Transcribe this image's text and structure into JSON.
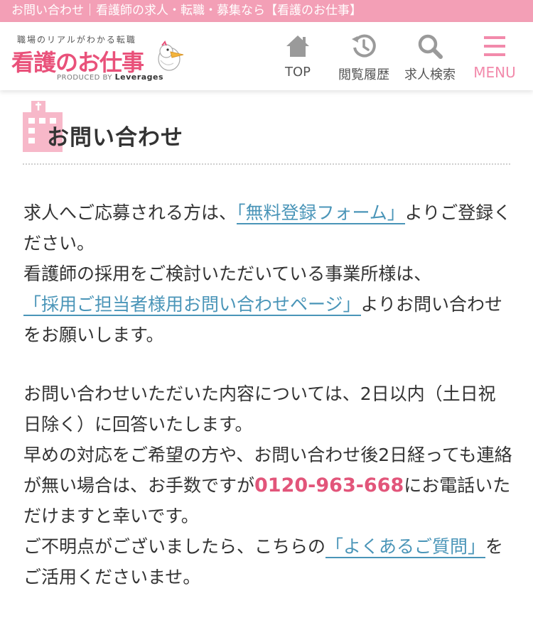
{
  "browser": {
    "page_title": "お問い合わせ｜看護師の求人・転職・募集なら【看護のお仕事】"
  },
  "colors": {
    "brand_pink": "#e9517a",
    "topbar_pink": "#f39fb6",
    "link_blue": "#4a95b8",
    "tel_pink": "#e2557a"
  },
  "header": {
    "logo": {
      "tagline": "職場のリアルがわかる転職",
      "name": "看護のお仕事",
      "produced_by": "PRODUCED BY",
      "company": "Leverages",
      "icon": "pelican-mascot-icon"
    },
    "nav": [
      {
        "label": "TOP",
        "icon": "home-icon"
      },
      {
        "label": "閲覧履歴",
        "icon": "history-icon"
      },
      {
        "label": "求人検索",
        "icon": "search-icon"
      },
      {
        "label": "MENU",
        "icon": "hamburger-menu-icon"
      }
    ]
  },
  "page": {
    "title": "お問い合わせ",
    "title_icon": "building-icon"
  },
  "content": {
    "para1": {
      "t1": "求人へご応募される方は、",
      "link1": "「無料登録フォーム」",
      "t2": "よりご登録ください。",
      "t3": "看護師の採用をご検討いただいている事業所様は、",
      "link2": "「採用ご担当者様用お問い合わせページ」",
      "t4": "よりお問い合わせをお願いします。"
    },
    "para2": {
      "t1": "お問い合わせいただいた内容については、2日以内（土日祝日除く）に回答いたします。",
      "t2": "早めの対応をご希望の方や、お問い合わせ後2日経っても連絡が無い場合は、お手数ですが",
      "tel": "0120-963-668",
      "t3": "にお電話いただけますと幸いです。",
      "t4": "ご不明点がございましたら、こちらの",
      "link3": "「よくあるご質問」",
      "t5": "をご活用くださいませ。"
    }
  }
}
